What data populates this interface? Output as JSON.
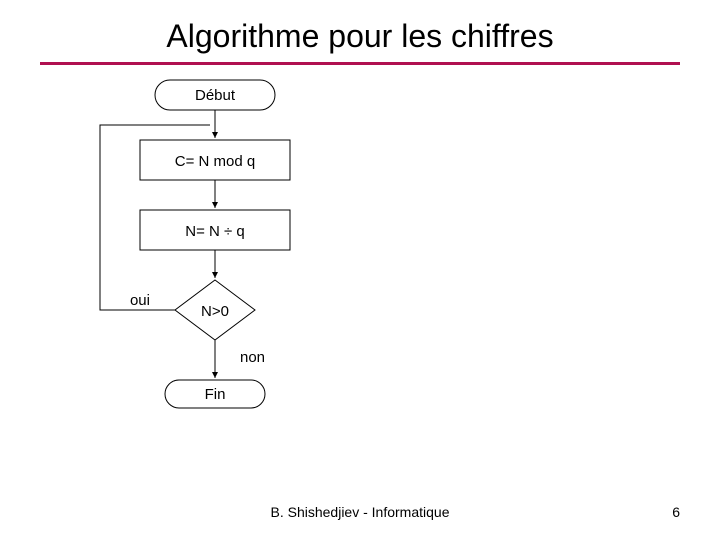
{
  "title": "Algorithme pour les chiffres",
  "footer": "B. Shishedjiev - Informatique",
  "page_number": "6",
  "flow": {
    "start": "Début",
    "step1": "C= N mod q",
    "step2": "N= N ÷ q",
    "decision": "N>0",
    "branch_yes": "oui",
    "branch_no": "non",
    "end": "Fin"
  },
  "chart_data": {
    "type": "diagram",
    "subtype": "flowchart",
    "nodes": [
      {
        "id": "start",
        "shape": "terminator",
        "label": "Début"
      },
      {
        "id": "s1",
        "shape": "process",
        "label": "C= N mod q"
      },
      {
        "id": "s2",
        "shape": "process",
        "label": "N= N ÷ q"
      },
      {
        "id": "d",
        "shape": "decision",
        "label": "N>0"
      },
      {
        "id": "end",
        "shape": "terminator",
        "label": "Fin"
      }
    ],
    "edges": [
      {
        "from": "start",
        "to": "s1"
      },
      {
        "from": "s1",
        "to": "s2"
      },
      {
        "from": "s2",
        "to": "d"
      },
      {
        "from": "d",
        "to": "s1",
        "label": "oui"
      },
      {
        "from": "d",
        "to": "end",
        "label": "non"
      }
    ]
  }
}
